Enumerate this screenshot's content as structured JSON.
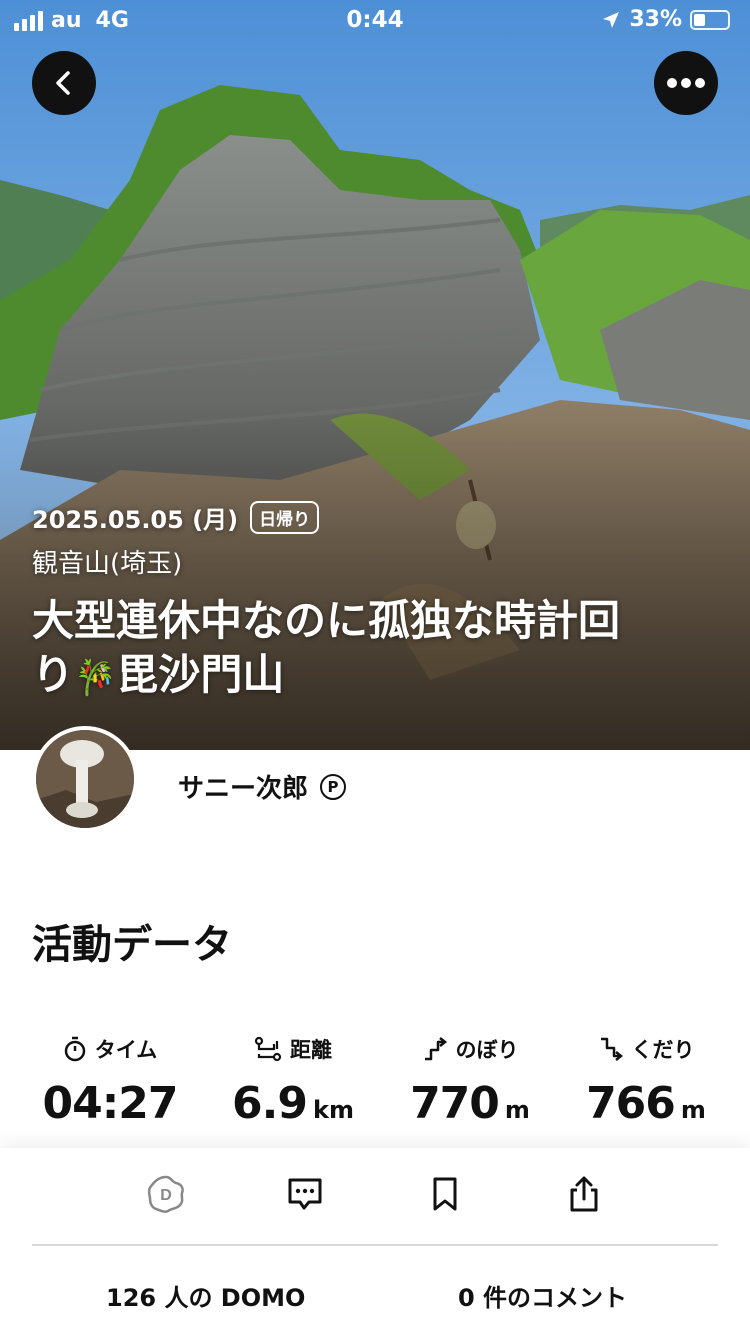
{
  "status_bar": {
    "carrier": "au",
    "network": "4G",
    "time": "0:44",
    "battery": "33%"
  },
  "hero": {
    "date": "2025.05.05 (月)",
    "trip_type_badge": "日帰り",
    "mountain": "観音山(埼玉)",
    "title_line1": "大型連休中なのに孤独な時計回",
    "title_line2": "り",
    "title_emoji": "🎋",
    "title_line2_rest": "毘沙門山"
  },
  "user": {
    "name": "サニー次郎",
    "premium_badge": "P"
  },
  "activity": {
    "section_title": "活動データ",
    "stats": [
      {
        "label": "タイム",
        "value": "04:27",
        "unit": "",
        "icon": "stopwatch-icon"
      },
      {
        "label": "距離",
        "value": "6.9",
        "unit": "km",
        "icon": "route-icon"
      },
      {
        "label": "のぼり",
        "value": "770",
        "unit": "m",
        "icon": "ascent-icon"
      },
      {
        "label": "くだり",
        "value": "766",
        "unit": "m",
        "icon": "descent-icon"
      }
    ]
  },
  "bottom": {
    "domo_count": "126 人の DOMO",
    "comment_count": "0 件のコメント"
  }
}
